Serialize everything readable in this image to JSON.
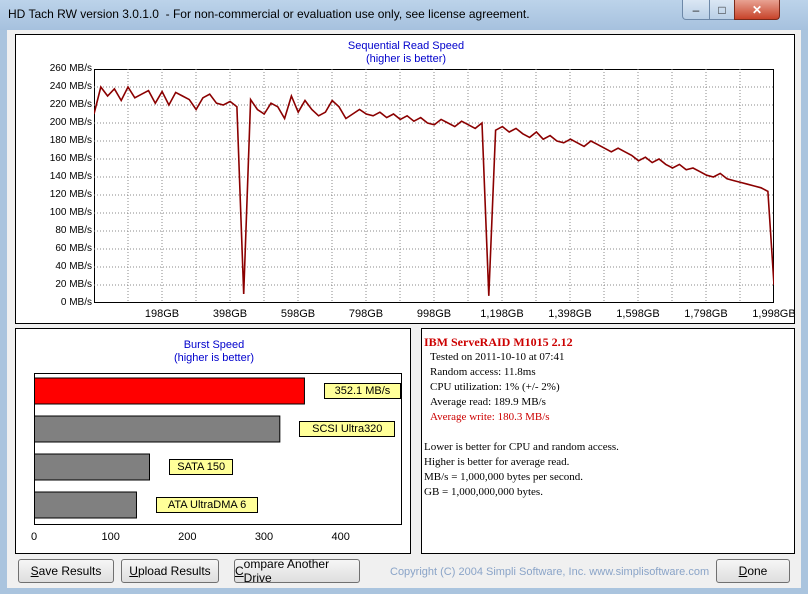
{
  "window": {
    "title": "HD Tach RW version 3.0.1.0  - For non-commercial or evaluation use only, see license agreement.",
    "minimize": "–",
    "maximize": "□",
    "close": "✕"
  },
  "read_chart": {
    "title": "Sequential Read Speed",
    "subtitle": "(higher is better)",
    "y_ticks": [
      "260 MB/s",
      "240 MB/s",
      "220 MB/s",
      "200 MB/s",
      "180 MB/s",
      "160 MB/s",
      "140 MB/s",
      "120 MB/s",
      "100 MB/s",
      "80 MB/s",
      "60 MB/s",
      "40 MB/s",
      "20 MB/s",
      "0 MB/s"
    ],
    "x_ticks": [
      "198GB",
      "398GB",
      "598GB",
      "798GB",
      "998GB",
      "1,198GB",
      "1,398GB",
      "1,598GB",
      "1,798GB",
      "1,998GB"
    ]
  },
  "chart_data": [
    {
      "type": "line",
      "title": "Sequential Read Speed",
      "subtitle": "(higher is better)",
      "ylim": [
        0,
        260
      ],
      "xlim": [
        0,
        1998
      ],
      "grid": true,
      "series": [
        {
          "color": "#8b0000",
          "x": [
            0,
            20,
            40,
            60,
            80,
            100,
            120,
            140,
            160,
            180,
            200,
            220,
            240,
            260,
            280,
            300,
            320,
            340,
            360,
            380,
            400,
            420,
            440,
            460,
            480,
            500,
            520,
            540,
            560,
            580,
            600,
            620,
            640,
            660,
            680,
            700,
            720,
            740,
            760,
            780,
            800,
            820,
            840,
            860,
            880,
            900,
            920,
            940,
            960,
            980,
            1000,
            1020,
            1040,
            1060,
            1080,
            1100,
            1120,
            1140,
            1160,
            1180,
            1200,
            1220,
            1240,
            1260,
            1280,
            1300,
            1320,
            1340,
            1360,
            1380,
            1400,
            1420,
            1440,
            1460,
            1480,
            1500,
            1520,
            1540,
            1560,
            1580,
            1600,
            1620,
            1640,
            1660,
            1680,
            1700,
            1720,
            1740,
            1760,
            1780,
            1800,
            1820,
            1840,
            1860,
            1880,
            1900,
            1920,
            1940,
            1960,
            1980,
            1998
          ],
          "y": [
            210,
            240,
            230,
            238,
            225,
            240,
            228,
            232,
            236,
            222,
            235,
            220,
            234,
            230,
            226,
            215,
            228,
            232,
            222,
            220,
            224,
            218,
            10,
            226,
            215,
            210,
            222,
            218,
            205,
            230,
            212,
            225,
            215,
            208,
            212,
            225,
            218,
            205,
            210,
            215,
            210,
            208,
            212,
            206,
            210,
            204,
            208,
            202,
            206,
            200,
            198,
            204,
            200,
            196,
            202,
            198,
            194,
            200,
            8,
            192,
            196,
            190,
            194,
            188,
            184,
            190,
            182,
            186,
            180,
            178,
            182,
            178,
            174,
            180,
            176,
            172,
            168,
            172,
            168,
            164,
            158,
            162,
            156,
            160,
            154,
            150,
            154,
            148,
            150,
            146,
            142,
            140,
            144,
            138,
            136,
            134,
            132,
            130,
            128,
            124,
            20
          ]
        }
      ]
    },
    {
      "type": "bar",
      "title": "Burst Speed",
      "subtitle": "(higher is better)",
      "categories": [
        "IBM ServeRAID M1015",
        "SCSI Ultra320",
        "SATA 150",
        "ATA UltraDMA 6"
      ],
      "values": [
        352.1,
        320,
        150,
        133
      ],
      "data_labels": [
        "352.1 MB/s",
        "SCSI Ultra320",
        "SATA 150",
        "ATA UltraDMA 6"
      ],
      "colors": [
        "#ff0000",
        "#808080",
        "#808080",
        "#808080"
      ],
      "x_ticks": [
        "0",
        "100",
        "200",
        "300",
        "400"
      ],
      "xlim": [
        0,
        480
      ]
    }
  ],
  "info": {
    "drive_name": "IBM ServeRAID M1015 2.12",
    "tested_on": "Tested on 2011-10-10 at 07:41",
    "random_access": "Random access: 11.8ms",
    "cpu_utilization": "CPU utilization: 1% (+/- 2%)",
    "average_read": "Average read: 189.9 MB/s",
    "average_write": "Average write: 180.3 MB/s",
    "note1": "Lower is better for CPU and random access.",
    "note2": "Higher is better for average read.",
    "note3": "MB/s = 1,000,000 bytes per second.",
    "note4": "GB = 1,000,000,000 bytes."
  },
  "buttons": {
    "save_prefix": "S",
    "save_rest": "ave Results",
    "upload_prefix": "U",
    "upload_rest": "pload Results",
    "compare_prefix": "C",
    "compare_rest": "ompare Another Drive",
    "done_prefix": "D",
    "done_rest": "one"
  },
  "copyright": "Copyright (C) 2004 Simpli Software, Inc. www.simplisoftware.com",
  "colors": {
    "read_line": "#8b0000",
    "write_line": "#ff0000",
    "drive_title": "#cc0000",
    "chart_title": "#0000cc"
  }
}
